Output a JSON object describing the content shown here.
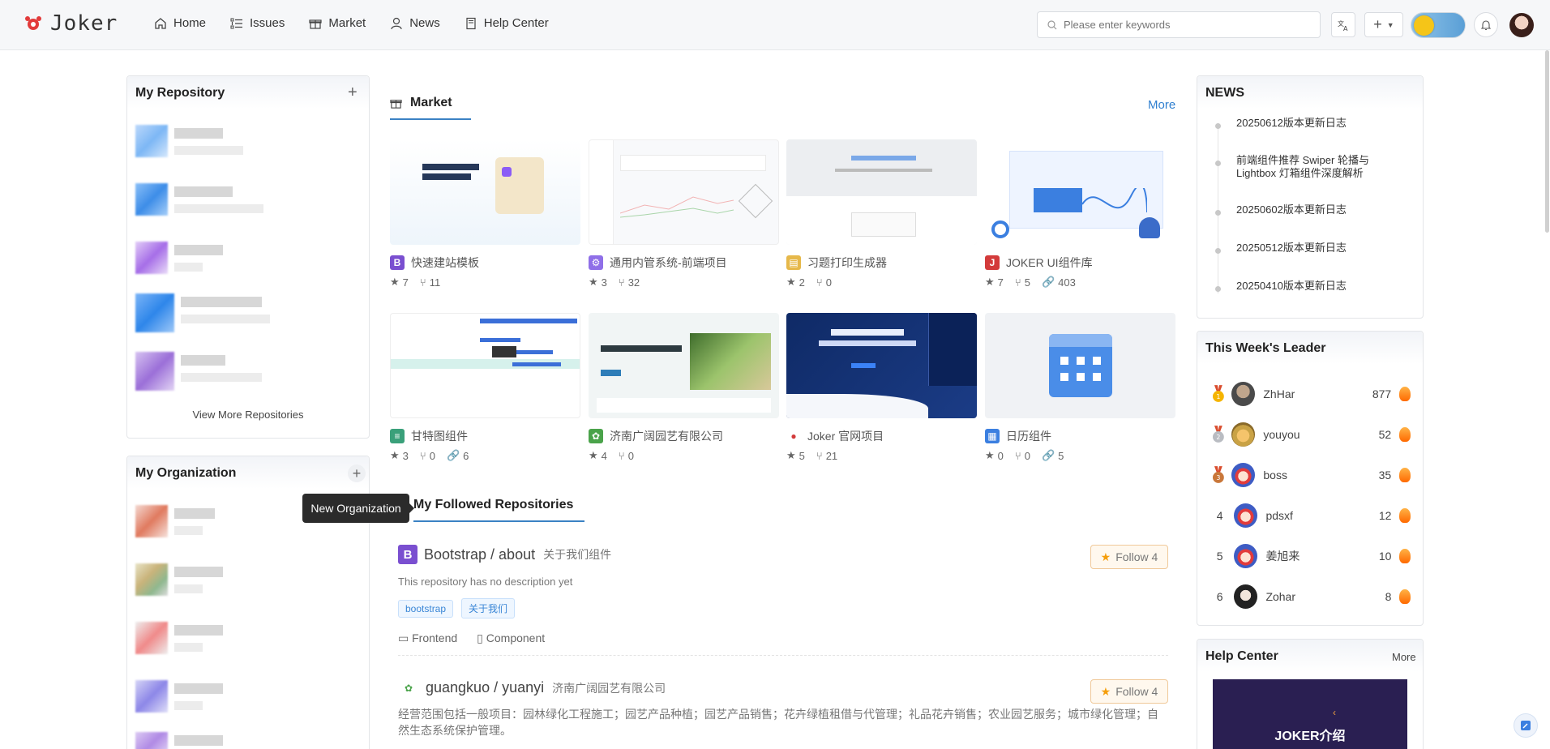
{
  "header": {
    "logo_text": "Joker",
    "nav": [
      {
        "label": "Home",
        "icon": "home-icon"
      },
      {
        "label": "Issues",
        "icon": "list-icon"
      },
      {
        "label": "Market",
        "icon": "gift-icon"
      },
      {
        "label": "News",
        "icon": "user-icon"
      },
      {
        "label": "Help Center",
        "icon": "book-icon"
      }
    ],
    "search_placeholder": "Please enter keywords"
  },
  "left": {
    "repo_title": "My Repository",
    "view_more": "View More Repositories",
    "org_title": "My Organization",
    "tooltip": "New Organization"
  },
  "market": {
    "title": "Market",
    "more": "More",
    "cards": [
      {
        "name": "快速建站模板",
        "stars": "7",
        "forks": "11",
        "links": "",
        "icon_color": "#7a4fd0",
        "icon_char": "B"
      },
      {
        "name": "通用内管系统-前端项目",
        "stars": "3",
        "forks": "32",
        "links": "",
        "icon_color": "#8f6fe8",
        "icon_char": "⚙"
      },
      {
        "name": "习题打印生成器",
        "stars": "2",
        "forks": "0",
        "links": "",
        "icon_color": "#e6b84a",
        "icon_char": "▤"
      },
      {
        "name": "JOKER UI组件库",
        "stars": "7",
        "forks": "5",
        "links": "403",
        "icon_color": "#d33b3b",
        "icon_char": "J"
      },
      {
        "name": "甘特图组件",
        "stars": "3",
        "forks": "0",
        "links": "6",
        "icon_color": "#3aa07a",
        "icon_char": "≡"
      },
      {
        "name": "济南广阔园艺有限公司",
        "stars": "4",
        "forks": "0",
        "links": "",
        "icon_color": "#4aa34a",
        "icon_char": "✿"
      },
      {
        "name": "Joker 官网项目",
        "stars": "5",
        "forks": "21",
        "links": "",
        "icon_color": "#d33b3b",
        "icon_char": "●"
      },
      {
        "name": "日历组件",
        "stars": "0",
        "forks": "0",
        "links": "5",
        "icon_color": "#3b7fe0",
        "icon_char": "▦"
      }
    ]
  },
  "followed": {
    "title": "My Followed Repositories",
    "repos": [
      {
        "name": "Bootstrap / about",
        "sub": "关于我们组件",
        "follow": "Follow 4",
        "desc": "This repository has no description yet",
        "tags": [
          "bootstrap",
          "关于我们"
        ],
        "meta": [
          "Frontend",
          "Component"
        ]
      },
      {
        "name": "guangkuo / yuanyi",
        "sub": "济南广阔园艺有限公司",
        "follow": "Follow 4",
        "desc": "经营范围包括一般项目：园林绿化工程施工；园艺产品种植；园艺产品销售；花卉绿植租借与代管理；礼品花卉销售；农业园艺服务；城市绿化管理；自然生态系统保护管理。"
      }
    ]
  },
  "news": {
    "title": "NEWS",
    "items": [
      "20250612版本更新日志",
      "前端组件推荐 Swiper 轮播与 Lightbox 灯箱组件深度解析",
      "20250602版本更新日志",
      "20250512版本更新日志",
      "20250410版本更新日志"
    ]
  },
  "leaders": {
    "title": "This Week's Leader",
    "rows": [
      {
        "rank": "1",
        "name": "ZhHar",
        "score": "877"
      },
      {
        "rank": "2",
        "name": "youyou",
        "score": "52"
      },
      {
        "rank": "3",
        "name": "boss",
        "score": "35"
      },
      {
        "rank": "4",
        "name": "pdsxf",
        "score": "12"
      },
      {
        "rank": "5",
        "name": "姜旭来",
        "score": "10"
      },
      {
        "rank": "6",
        "name": "Zohar",
        "score": "8"
      }
    ]
  },
  "help": {
    "title": "Help Center",
    "more": "More",
    "banner_text": "JOKER介绍"
  }
}
